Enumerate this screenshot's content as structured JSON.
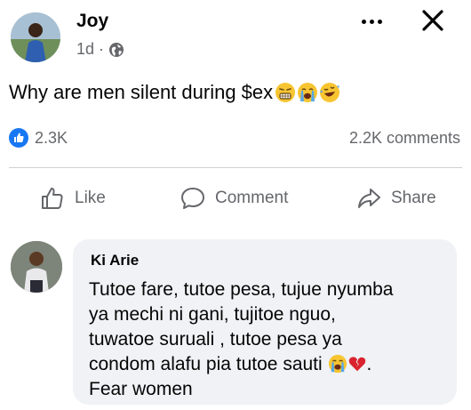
{
  "post": {
    "author": "Joy",
    "time": "1d ·",
    "text": "Why are men silent during $ex",
    "reaction_count": "2.3K",
    "comments_count": "2.2K comments"
  },
  "actions": {
    "like": "Like",
    "comment": "Comment",
    "share": "Share"
  },
  "comment": {
    "author": "Ki Arie",
    "lines": [
      "Tutoe fare, tutoe pesa, tujue nyumba",
      "ya mechi ni gani, tujitoe nguo,",
      "tuwatoe suruali , tutoe pesa ya",
      "condom alafu pia tutoe sauti",
      "Fear women"
    ],
    "line4_suffix": "."
  },
  "colors": {
    "like_blue": "#1877f2",
    "emoji_yellow": "#f7c531",
    "heart_red": "#d9232f",
    "secondary_text": "#65676b",
    "bubble_bg": "#f0f2f5"
  },
  "icons": {
    "post_emojis": [
      "grimacing-face-emoji",
      "loudly-crying-face-emoji",
      "rolling-laughing-emoji"
    ],
    "comment_emojis": [
      "loudly-crying-face-emoji",
      "broken-heart-emoji"
    ]
  }
}
